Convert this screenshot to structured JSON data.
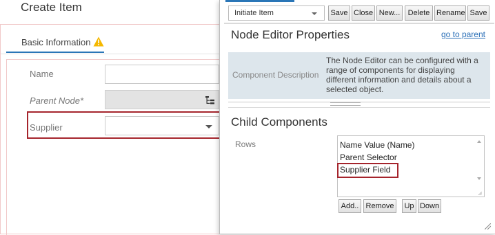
{
  "left": {
    "title": "Create Item",
    "tab_label": "Basic Information",
    "fields": {
      "name": {
        "label": "Name",
        "value": ""
      },
      "parent": {
        "label": "Parent Node*",
        "value": ""
      },
      "supplier": {
        "label": "Supplier",
        "value": ""
      }
    }
  },
  "node_editor": {
    "select_value": "Initiate Item",
    "toolbar": {
      "save": "Save",
      "close": "Close",
      "new": "New...",
      "delete": "Delete",
      "rename": "Rename",
      "save2": "Save"
    },
    "title": "Node Editor Properties",
    "goto_parent": "go to parent",
    "description_label": "Component Description",
    "description_text": "The Node Editor can be configured with a range of components for displaying different information and details about a selected object.",
    "child_title": "Child Components",
    "rows_label": "Rows",
    "rows": [
      "Name Value (Name)",
      "Parent Selector",
      "Supplier Field"
    ],
    "buttons": {
      "add": "Add..",
      "remove": "Remove",
      "up": "Up",
      "down": "Down"
    }
  },
  "colors": {
    "accent": "#2a76b7",
    "highlight": "#a5242c",
    "warning": "#f5b800",
    "description_bg": "#dde6ec"
  },
  "icons": {
    "warning": "warning-icon",
    "tree": "tree-icon",
    "dropdown": "chevron-down-icon",
    "resize": "resize-grip-icon"
  }
}
